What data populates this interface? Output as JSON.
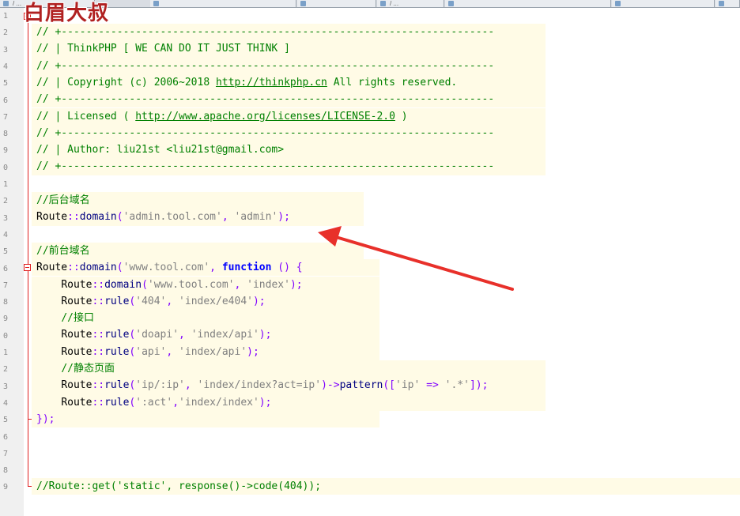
{
  "watermark": "白眉大叔",
  "tabs": [
    {
      "label": "/ ..."
    },
    {
      "label": ""
    },
    {
      "label": ""
    },
    {
      "label": "/ ..."
    },
    {
      "label": ""
    },
    {
      "label": ""
    }
  ],
  "gutter_numbers": [
    "1",
    "2",
    "3",
    "4",
    "5",
    "6",
    "7",
    "8",
    "9",
    "0",
    "1",
    "2",
    "3",
    "4",
    "5",
    "6",
    "7",
    "8",
    "9",
    "0",
    "1",
    "2",
    "3",
    "4",
    "5",
    "6",
    "7",
    "8",
    "9"
  ],
  "code": {
    "rule_line": "// +----------------------------------------------------------------------",
    "header_title": "// | ThinkPHP [ WE CAN DO IT JUST THINK ]",
    "copyright_pre": "// | Copyright (c) 2006~2018 ",
    "copyright_link": "http://thinkphp.cn",
    "copyright_post": " All rights reserved.",
    "license_pre": "// | Licensed ( ",
    "license_link": "http://www.apache.org/licenses/LICENSE-2.0",
    "license_post": " )",
    "author": "// | Author: liu21st <liu21st@gmail.com>",
    "comment_backend": "//后台域名",
    "route_class": "Route",
    "dcolon": "::",
    "fn_domain": "domain",
    "fn_rule": "rule",
    "fn_pattern": "pattern",
    "admin_domain_str": "'admin.tool.com'",
    "admin_str": "'admin'",
    "comment_frontend": "//前台域名",
    "www_domain_str": "'www.tool.com'",
    "kw_function": "function",
    "index_str": "'index'",
    "s404": "'404'",
    "s_index_e404": "'index/e404'",
    "comment_api": "//接口",
    "s_doapi": "'doapi'",
    "s_index_api": "'index/api'",
    "s_api": "'api'",
    "comment_static": "//静态页面",
    "s_ip_ip": "'ip/:ip'",
    "s_index_index_act": "'index/index?act=ip'",
    "s_ip": "'ip'",
    "s_dotstar": "'.*'",
    "s_act": "':act'",
    "s_index_index": "'index/index'",
    "close_brace": "});",
    "last_line": "//Route::get('static', response()->code(404));"
  },
  "colors": {
    "arrow": "#e8302a",
    "comment": "#008000",
    "keyword": "#0000ff",
    "operator": "#8000ff",
    "string": "#808080"
  }
}
